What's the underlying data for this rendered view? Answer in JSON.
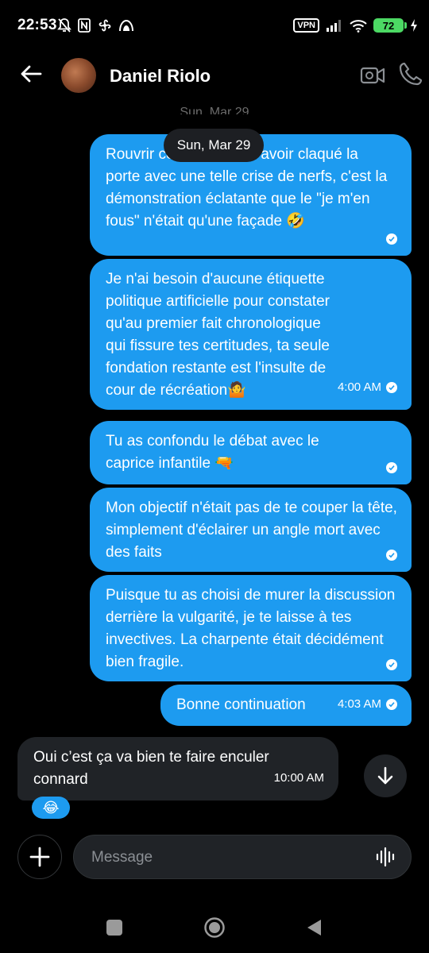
{
  "status_bar": {
    "time": "22:53",
    "vpn": "VPN",
    "battery": "72"
  },
  "header": {
    "contact_name": "Daniel Riolo"
  },
  "date_separator": {
    "ghost": "Sun, Mar 29",
    "chip": "Sun, Mar 29"
  },
  "messages": [
    {
      "direction": "out",
      "text": "Rouvrir ce canal après avoir claqué la porte avec une telle crise de nerfs, c'est la démonstration éclatante que le \"je m'en fous\" n'était qu'une façade 🤣",
      "time": "",
      "read": true
    },
    {
      "direction": "out",
      "text": "Je n'ai besoin d'aucune étiquette politique artificielle pour constater qu'au premier fait chronologique qui fissure tes certitudes, ta seule fondation restante est l'insulte de cour de récréation🤷",
      "time": "4:00 AM",
      "read": true
    },
    {
      "direction": "out",
      "text": "Tu as confondu le débat avec le caprice infantile 🔫",
      "time": "",
      "read": true
    },
    {
      "direction": "out",
      "text": "Mon objectif n'était pas de te couper la tête, simplement d'éclairer un angle mort avec des faits",
      "time": "",
      "read": true
    },
    {
      "direction": "out",
      "text": "Puisque tu as choisi de murer la discussion derrière la vulgarité, je te laisse à tes invectives. La charpente était décidément bien fragile.",
      "time": "",
      "read": true
    },
    {
      "direction": "out",
      "text": "Bonne continuation",
      "time": "4:03 AM",
      "read": true
    },
    {
      "direction": "in",
      "text": "Oui c’est ça va bien te faire enculer connard",
      "time": "10:00 AM",
      "reaction": "😂"
    }
  ],
  "composer": {
    "placeholder": "Message"
  }
}
